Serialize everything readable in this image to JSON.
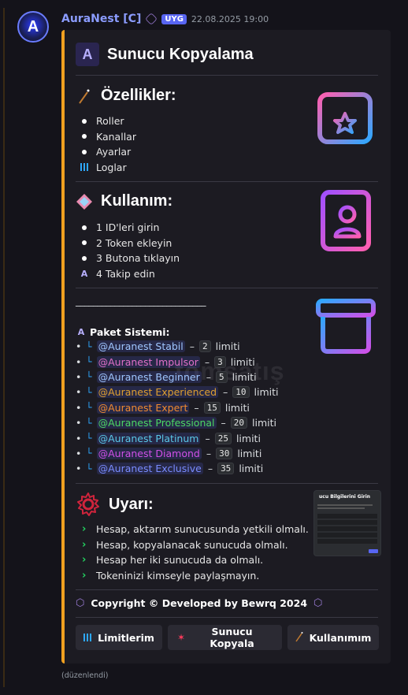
{
  "message": {
    "username": "AuraNest [C]",
    "badge": "UYG",
    "timestamp": "22.08.2025 19:00",
    "edited_note": "(düzenlendi)"
  },
  "embed": {
    "accent_color": "#f0a020",
    "title": "Sunucu Kopyalama",
    "features": {
      "heading": "Özellikler:",
      "items": [
        "Roller",
        "Kanallar",
        "Ayarlar",
        "Loglar"
      ]
    },
    "usage": {
      "heading": "Kullanım:",
      "items": [
        "1 ID'leri girin",
        "2 Token ekleyin",
        "3 Butona tıklayın",
        "4 Takip edin"
      ]
    },
    "divider_text": "______________________________",
    "packages": {
      "heading": "Paket Sistemi:",
      "limit_word": "limiti",
      "items": [
        {
          "name": "@Auranest Stabil",
          "limit": "2",
          "color": "#9fc6ff"
        },
        {
          "name": "@Auranest Impulsor",
          "limit": "3",
          "color": "#e06fc8"
        },
        {
          "name": "@Auranest Beginner",
          "limit": "5",
          "color": "#9fc6ff"
        },
        {
          "name": "@Auranest Experienced",
          "limit": "10",
          "color": "#e0a030"
        },
        {
          "name": "@Auranest Expert",
          "limit": "15",
          "color": "#f08a30"
        },
        {
          "name": "@Auranest Professional",
          "limit": "20",
          "color": "#4cd964"
        },
        {
          "name": "@Auranest Platinum",
          "limit": "25",
          "color": "#5ac8e8"
        },
        {
          "name": "@Auranest Diamond",
          "limit": "30",
          "color": "#d050e8"
        },
        {
          "name": "@Auranest Exclusive",
          "limit": "35",
          "color": "#7a8cff"
        }
      ]
    },
    "warning": {
      "heading": "Uyarı:",
      "items": [
        "Hesap, aktarım sunucusunda yetkili olmalı.",
        "Hesap, kopyalanacak sunucuda olmalı.",
        "Hesap her iki sunucuda da olmalı.",
        "Tokeninizi kimseyle paylaşmayın."
      ],
      "thumbnail_title": "ucu Bilgilerini Girin"
    },
    "copyright": "Copyright © Developed by Bewrq 2024"
  },
  "buttons": [
    {
      "label": "Limitlerim",
      "icon": "bar-chart-icon"
    },
    {
      "label": "Sunucu Kopyala",
      "icon": "sparkle-icon"
    },
    {
      "label": "Kullanımım",
      "icon": "wand-icon"
    }
  ],
  "watermark": "tomsatış"
}
